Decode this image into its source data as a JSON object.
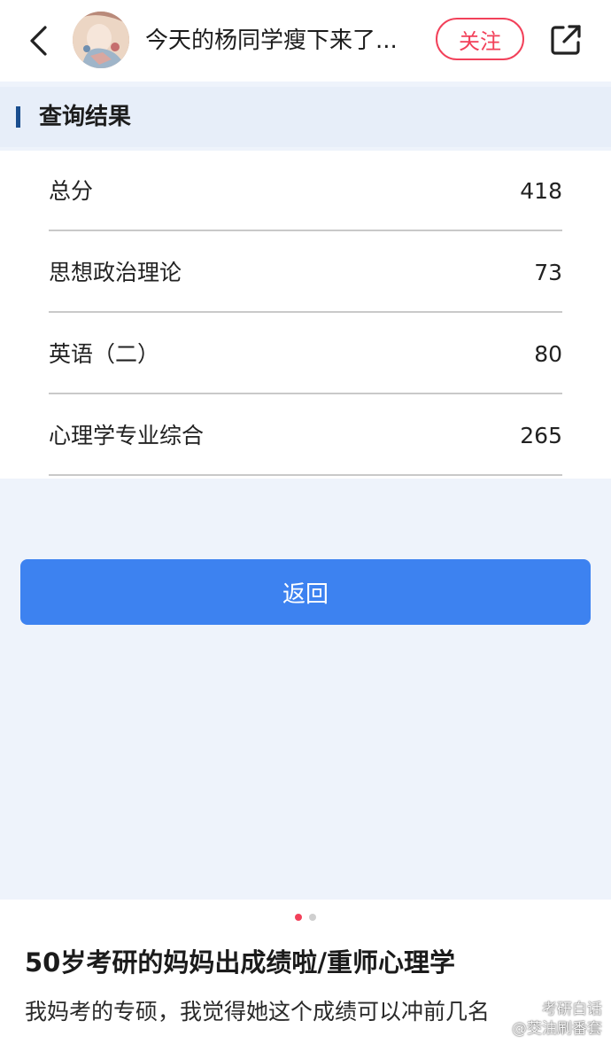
{
  "header": {
    "title": "今天的杨同学瘦下来了...",
    "follow_label": "关注",
    "back_icon": "chevron-left-icon",
    "share_icon": "share-icon",
    "accent_color": "#f2415a"
  },
  "result_page": {
    "section_title": "查询结果",
    "rows": [
      {
        "label": "总分",
        "value": "418"
      },
      {
        "label": "思想政治理论",
        "value": "73"
      },
      {
        "label": "英语（二）",
        "value": "80"
      },
      {
        "label": "心理学专业综合",
        "value": "265"
      }
    ],
    "return_label": "返回",
    "button_color": "#3d82f0"
  },
  "carousel": {
    "current": 1,
    "total": 2
  },
  "post": {
    "headline": "50岁考研的妈妈出成绩啦/重师心理学",
    "body": "我妈考的专硕，我觉得她这个成绩可以冲前几名"
  },
  "watermark": {
    "line1": "考研白话",
    "line2": "@茭油刷番套"
  }
}
